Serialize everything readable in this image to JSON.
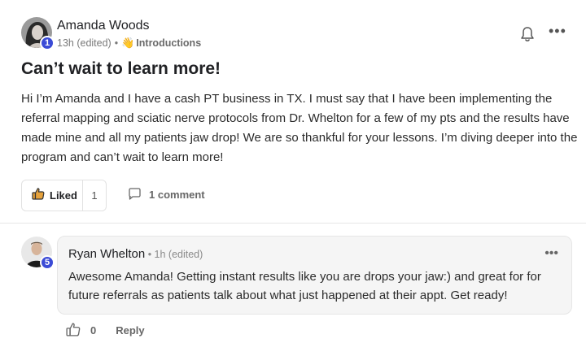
{
  "post": {
    "author": "Amanda Woods",
    "author_level": "1",
    "time": "13h (edited)",
    "separator": "•",
    "category_icon": "waving-hand-icon",
    "category": "Introductions",
    "title": "Can’t wait to learn more!",
    "body": "Hi I’m Amanda and I have a cash PT business in TX. I must say that I have been implementing the referral mapping and sciatic nerve protocols from Dr. Whelton for a few of my pts and the results have made mine and all my patients jaw drop! We are so thankful for your lessons. I’m diving deeper into the program and can’t wait to learn more!",
    "like_label": "Liked",
    "like_count": "1",
    "comment_count_label": "1 comment",
    "more_label": "•••"
  },
  "comment": {
    "author": "Ryan Whelton",
    "author_level": "5",
    "meta": " • 1h (edited)",
    "body": "Awesome Amanda! Getting instant results like you are drops your jaw:) and great for for future referrals as patients talk about what just happened at their appt. Get ready!",
    "more_label": "•••",
    "like_count": "0",
    "reply_label": "Reply"
  },
  "colors": {
    "level_badge": "#3b4bd6",
    "liked_thumb": "#e6a23c",
    "bubble_bg": "#f5f5f5"
  }
}
